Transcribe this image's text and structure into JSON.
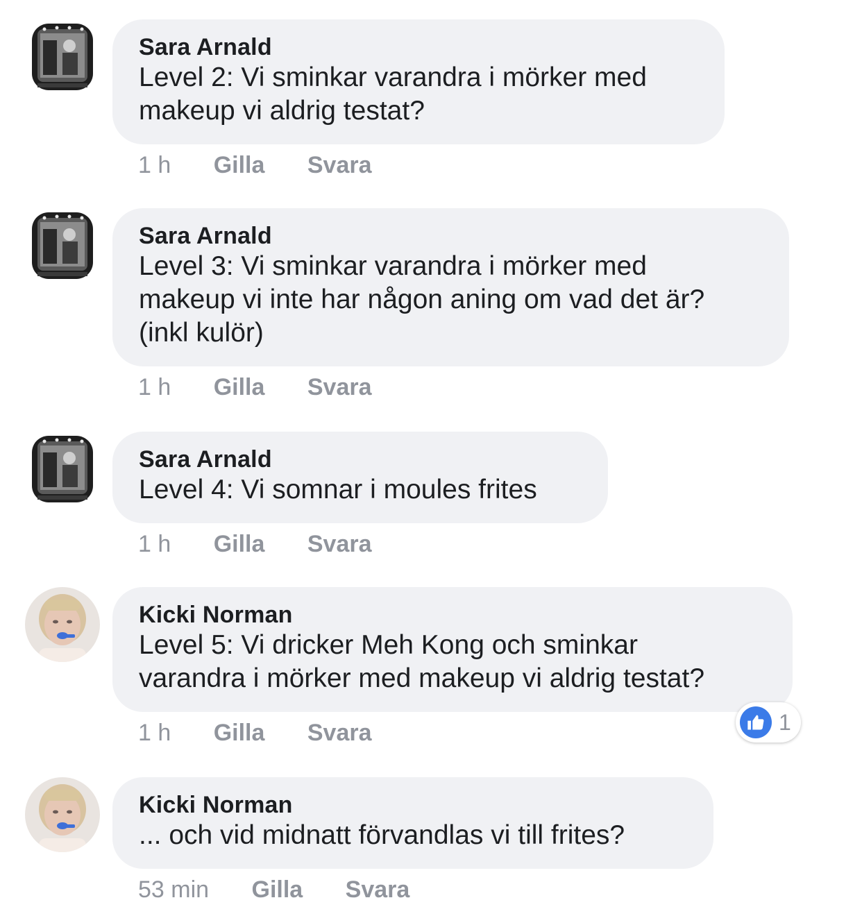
{
  "comments": [
    {
      "author": "Sara Arnald",
      "text": "Level 2: Vi sminkar varandra i mörker med\nmakeup vi aldrig testat?",
      "time": "1 h",
      "like_label": "Gilla",
      "reply_label": "Svara",
      "avatar": "mirror-photo-avatar"
    },
    {
      "author": "Sara Arnald",
      "text": "Level 3: Vi sminkar varandra i mörker med\nmakeup vi inte har någon aning om vad det är?\n(inkl kulör)",
      "time": "1 h",
      "like_label": "Gilla",
      "reply_label": "Svara",
      "avatar": "mirror-photo-avatar"
    },
    {
      "author": "Sara Arnald",
      "text": "Level 4: Vi somnar i moules frites",
      "time": "1 h",
      "like_label": "Gilla",
      "reply_label": "Svara",
      "avatar": "mirror-photo-avatar"
    },
    {
      "author": "Kicki Norman",
      "text": "Level 5: Vi dricker Meh Kong och sminkar\nvarandra i mörker med makeup vi aldrig testat?",
      "time": "1 h",
      "like_label": "Gilla",
      "reply_label": "Svara",
      "avatar": "portrait-photo-avatar",
      "reaction": {
        "icon": "thumbs-up-icon",
        "count": "1"
      }
    },
    {
      "author": "Kicki Norman",
      "text": "... och vid midnatt förvandlas vi till frites?",
      "time": "53 min",
      "like_label": "Gilla",
      "reply_label": "Svara",
      "avatar": "portrait-photo-avatar"
    }
  ],
  "colors": {
    "bubble": "#f0f1f4",
    "meta": "#90949c",
    "text": "#1c1e21",
    "like_blue": "#3b7be8"
  }
}
